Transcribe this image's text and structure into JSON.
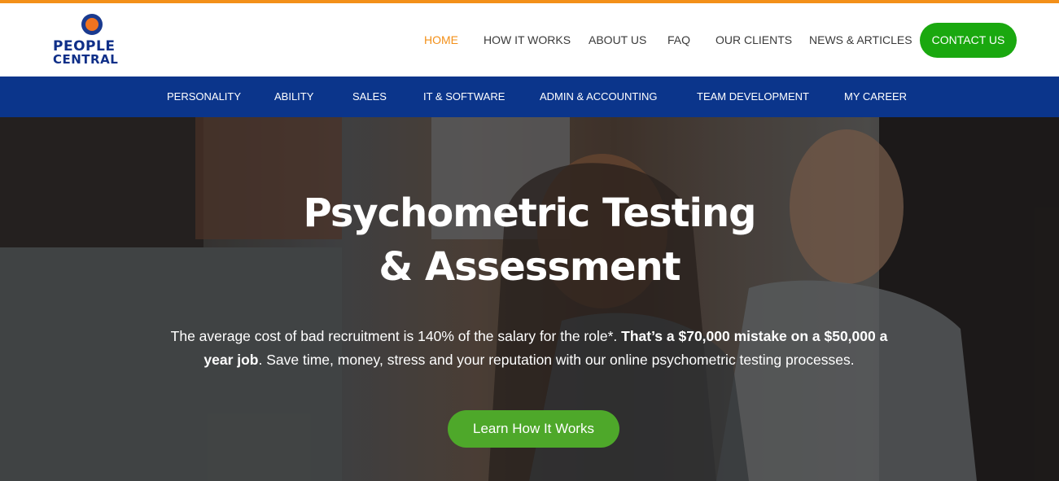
{
  "colors": {
    "accent": "#f39019",
    "brand_blue": "#0b358b",
    "contact_green": "#1aa80f",
    "cta_green": "#4ea82a"
  },
  "logo": {
    "line1": "PEOPLE",
    "line2": "CENTRAL",
    "icon": "circle-logo-icon"
  },
  "main_nav": {
    "items": [
      {
        "label": "HOME",
        "active": true
      },
      {
        "label": "HOW IT WORKS",
        "active": false
      },
      {
        "label": "ABOUT US",
        "active": false
      },
      {
        "label": "FAQ",
        "active": false
      },
      {
        "label": "OUR CLIENTS",
        "active": false
      },
      {
        "label": "NEWS & ARTICLES",
        "active": false
      }
    ],
    "contact_label": "CONTACT US"
  },
  "sub_nav": {
    "items": [
      {
        "label": "PERSONALITY"
      },
      {
        "label": "ABILITY"
      },
      {
        "label": "SALES"
      },
      {
        "label": "IT & SOFTWARE"
      },
      {
        "label": "ADMIN & ACCOUNTING"
      },
      {
        "label": "TEAM DEVELOPMENT"
      },
      {
        "label": "MY CAREER"
      }
    ]
  },
  "hero": {
    "title_line1": "Psychometric Testing",
    "title_line2": "& Assessment",
    "text_part1": "The average cost of bad recruitment is 140% of the salary for the role*. ",
    "text_bold": "That’s a $70,000 mistake on a $50,000 a year job",
    "text_part2": ". Save time, money, stress and your reputation with our online psychometric testing processes.",
    "cta_label": "Learn How It Works"
  }
}
